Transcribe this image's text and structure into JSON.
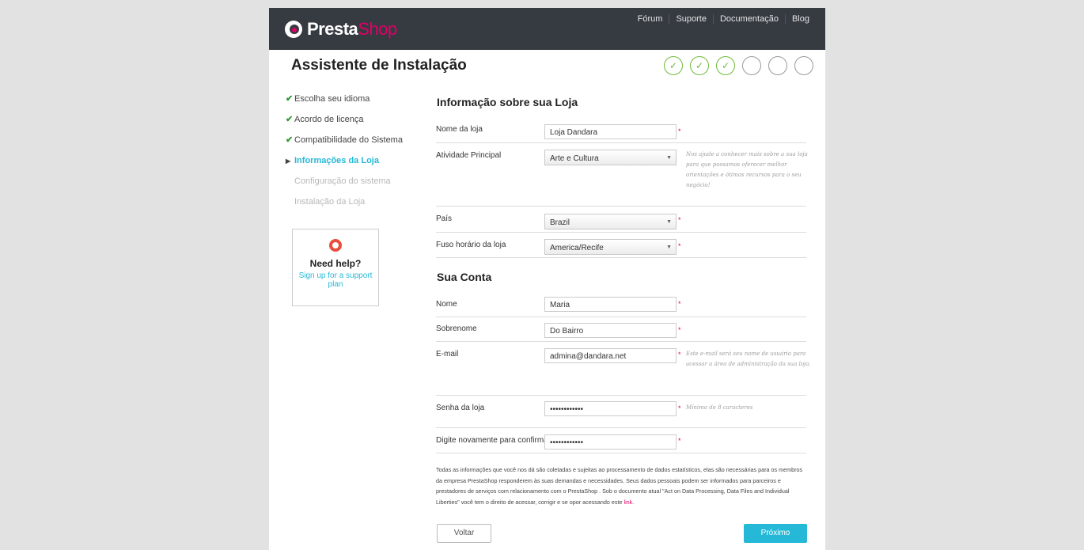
{
  "header": {
    "logo_presta": "Presta",
    "logo_shop": "Shop",
    "nav": [
      "Fórum",
      "Suporte",
      "Documentação",
      "Blog"
    ]
  },
  "wizard": {
    "title": "Assistente de Instalação",
    "steps_total": 6,
    "steps_done": 3,
    "check_glyph": "✓"
  },
  "sidebar": {
    "items": [
      {
        "label": "Escolha seu idioma",
        "state": "done"
      },
      {
        "label": "Acordo de licença",
        "state": "done"
      },
      {
        "label": "Compatibilidade do Sistema",
        "state": "done"
      },
      {
        "label": "Informações da Loja",
        "state": "current"
      },
      {
        "label": "Configuração do sistema",
        "state": "pending"
      },
      {
        "label": "Instalação da Loja",
        "state": "pending"
      }
    ],
    "help": {
      "title": "Need help?",
      "link": "Sign up for a support plan",
      "icon": "lifebuoy-icon"
    }
  },
  "store": {
    "heading": "Informação sobre sua Loja",
    "name_label": "Nome da loja",
    "name_value": "Loja Dandara",
    "activity_label": "Atividade Principal",
    "activity_value": "Arte e Cultura",
    "activity_hint": "Nos ajude a conhecer mais sobre a sua loja para que possamos oferecer melhor orientações e ótimos recursos para o seu negócio!",
    "country_label": "País",
    "country_value": "Brazil",
    "timezone_label": "Fuso horário da loja",
    "timezone_value": "America/Recife"
  },
  "account": {
    "heading": "Sua Conta",
    "first_label": "Nome",
    "first_value": "Maria",
    "last_label": "Sobrenome",
    "last_value": "Do Bairro",
    "email_label": "E-mail",
    "email_value": "admina@dandara.net",
    "email_hint": "Este e-mail será seu nome de usuário para acessar a área de administração da sua loja.",
    "password_label": "Senha da loja",
    "password_value": "••••••••••••",
    "password_hint": "Mínimo de 8 caracteres",
    "confirm_label": "Digite novamente para confirmar",
    "confirm_value": "••••••••••••"
  },
  "required_mark": "*",
  "privacy": {
    "text": "Todas as informações que você nos dá são coletadas e sujeitas ao processamento de dados estatísticos, elas são necessárias para os membros da empresa PrestaShop responderem às suas demandas e necessidades. Seus dados pessoais podem ser informados para parceiros e prestadores de serviços com relacionamento com o PrestaShop . Sob o documento atual \"Act on Data Processing, Data Files and Individual Liberties\" você tem o direito de acessar, corrigir e se opor acessando este ",
    "link": "link",
    "end": "."
  },
  "buttons": {
    "back": "Voltar",
    "next": "Próximo"
  },
  "colors": {
    "accent": "#25b9d7",
    "brand_pink": "#df0067",
    "success": "#6fba3a",
    "header_bg": "#363a41"
  }
}
